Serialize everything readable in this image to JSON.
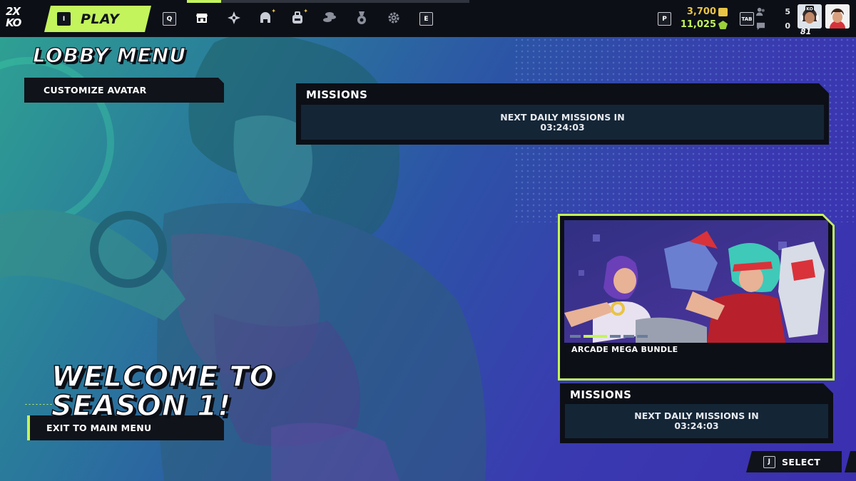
{
  "topbar": {
    "logo_line1": "2X",
    "logo_line2": "KO",
    "play_key": "I",
    "play_label": "PLAY",
    "nav_left_key": "Q",
    "nav_right_key": "E",
    "nav_icons": [
      "storefront-icon",
      "compass-icon",
      "fighter-helmet-icon",
      "backpack-icon",
      "coins-icon",
      "medal-icon",
      "gear-icon"
    ],
    "season_progress": 0.12,
    "currency_key": "P",
    "ko_points": "3,700",
    "gems": "11,025",
    "social_key": "TAB",
    "friends_count": "5",
    "messages_count": "0",
    "player_level": "81",
    "colors": {
      "accent": "#c3f45c",
      "bar_bg": "#0c0f16",
      "ko_gold": "#e8c446"
    }
  },
  "lobby": {
    "title": "LOBBY MENU",
    "customize_label": "CUSTOMIZE AVATAR",
    "exit_label": "EXIT TO MAIN MENU"
  },
  "missions_top": {
    "title": "MISSIONS",
    "next_label": "NEXT DAILY MISSIONS IN",
    "timer": "03:24:03"
  },
  "featured": {
    "bundle_name": "ARCADE MEGA BUNDLE",
    "page_count": 5,
    "active_page": 2
  },
  "missions_bottom": {
    "title": "MISSIONS",
    "next_label": "NEXT DAILY MISSIONS IN",
    "timer": "03:24:03"
  },
  "welcome": {
    "line1": "WELCOME TO",
    "line2": "SEASON 1!"
  },
  "prompt": {
    "select_key": "J",
    "select_label": "SELECT"
  }
}
